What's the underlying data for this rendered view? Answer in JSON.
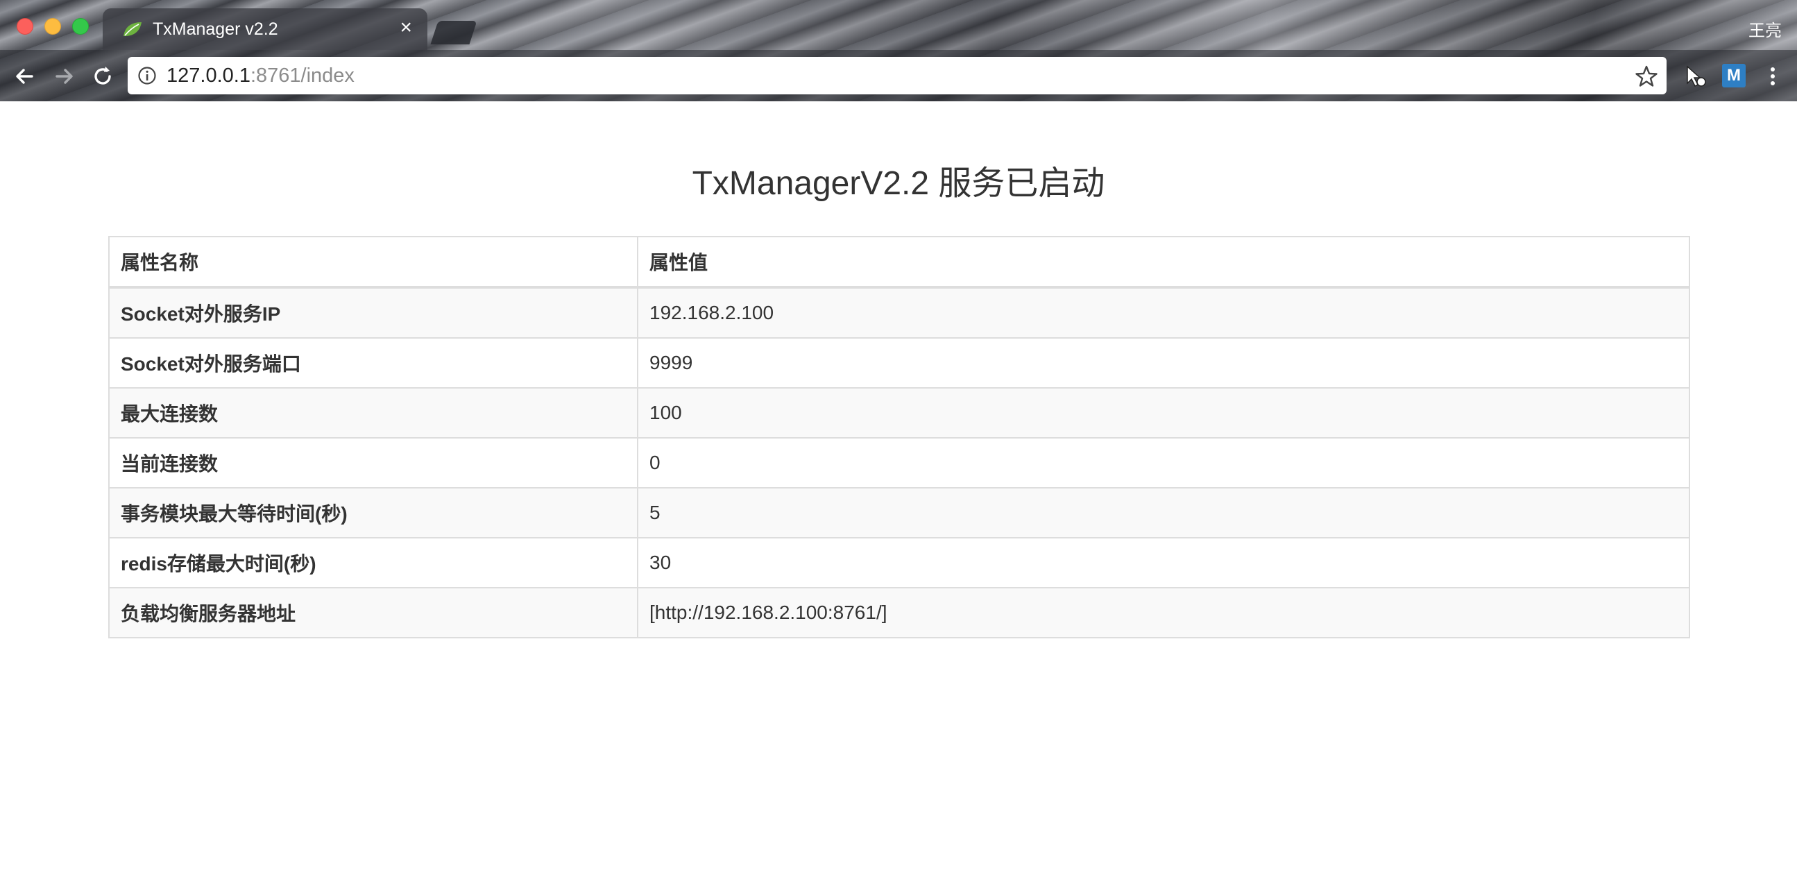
{
  "browser": {
    "tab_title": "TxManager v2.2",
    "tab_close": "×",
    "profile_name": "王亮",
    "url_host": "127.0.0.1",
    "url_rest": ":8761/index",
    "extension_label": "M"
  },
  "page": {
    "title": "TxManagerV2.2 服务已启动",
    "table": {
      "headers": [
        "属性名称",
        "属性值"
      ],
      "rows": [
        {
          "name": "Socket对外服务IP",
          "value": "192.168.2.100"
        },
        {
          "name": "Socket对外服务端口",
          "value": "9999"
        },
        {
          "name": "最大连接数",
          "value": "100"
        },
        {
          "name": "当前连接数",
          "value": "0"
        },
        {
          "name": "事务模块最大等待时间(秒)",
          "value": "5"
        },
        {
          "name": "redis存储最大时间(秒)",
          "value": "30"
        },
        {
          "name": "负载均衡服务器地址",
          "value": "[http://192.168.2.100:8761/]"
        }
      ]
    }
  },
  "icons": {
    "tab_favicon": "spring-leaf-icon",
    "back": "arrow-left-icon",
    "forward": "arrow-right-icon",
    "reload": "reload-icon",
    "info": "info-circle-icon",
    "bookmark": "star-icon",
    "cursor_ext": "cursor-extension-icon",
    "menu": "kebab-menu-icon"
  },
  "colors": {
    "favicon_green": "#6db33f",
    "table_border": "#dddddd",
    "stripe": "#f9f9f9"
  }
}
